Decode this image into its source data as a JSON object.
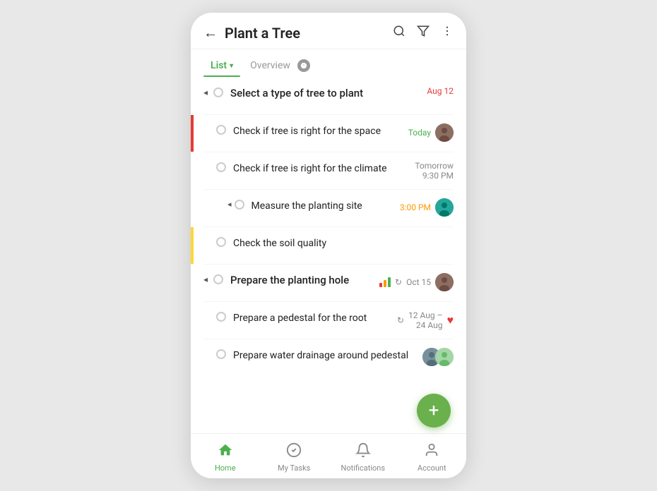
{
  "header": {
    "title": "Plant a Tree",
    "back_label": "←",
    "search_label": "🔍",
    "filter_label": "⚗",
    "more_label": "⋮"
  },
  "tabs": [
    {
      "id": "list",
      "label": "List",
      "active": true
    },
    {
      "id": "overview",
      "label": "Overview",
      "active": false
    }
  ],
  "tasks": [
    {
      "id": "t1",
      "name": "Select a type of tree to plant",
      "level": 0,
      "date": "Aug 12",
      "date_color": "red",
      "has_pin": true,
      "border": null
    },
    {
      "id": "t2",
      "name": "Check if tree is right for the space",
      "level": 1,
      "date": "Today",
      "date_color": "green",
      "has_avatar": true,
      "avatar_style": "brown",
      "border": "red"
    },
    {
      "id": "t3",
      "name": "Check if tree is right for the climate",
      "level": 1,
      "date": "Tomorrow\n9:30 PM",
      "date_color": "gray",
      "border": null
    },
    {
      "id": "t4",
      "name": "Measure the planting site",
      "level": 2,
      "date": "3:00 PM",
      "date_color": "orange",
      "has_pin": true,
      "has_avatar": true,
      "avatar_style": "teal",
      "border": null
    },
    {
      "id": "t5",
      "name": "Check the soil quality",
      "level": 1,
      "date": "",
      "date_color": "",
      "border": "yellow"
    },
    {
      "id": "t6",
      "name": "Prepare the planting hole",
      "level": 0,
      "date": "Oct 15",
      "date_color": "gray",
      "has_pin": true,
      "has_avatar": true,
      "avatar_style": "brown",
      "has_priority": true,
      "has_repeat": true,
      "border": null
    },
    {
      "id": "t7",
      "name": "Prepare a pedestal for the root",
      "level": 1,
      "date": "12 Aug –\n24 Aug",
      "date_color": "gray",
      "has_repeat": true,
      "has_heart": true,
      "border": null
    },
    {
      "id": "t8",
      "name": "Prepare water drainage around pedestal",
      "level": 1,
      "date": "",
      "date_color": "",
      "has_avatar_group": true,
      "border": null
    }
  ],
  "nav": [
    {
      "id": "home",
      "label": "Home",
      "icon": "🏠",
      "active": true
    },
    {
      "id": "tasks",
      "label": "My Tasks",
      "icon": "✓",
      "active": false
    },
    {
      "id": "notifications",
      "label": "Notifications",
      "icon": "🔔",
      "active": false
    },
    {
      "id": "account",
      "label": "Account",
      "icon": "👤",
      "active": false
    }
  ],
  "fab": {
    "label": "+"
  }
}
